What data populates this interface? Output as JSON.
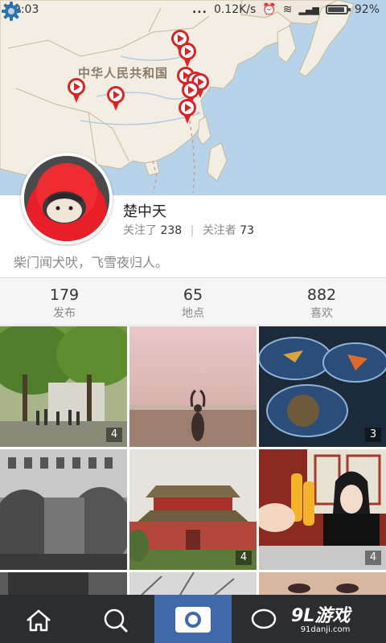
{
  "status_bar": {
    "time": "19:03",
    "dots": "...",
    "speed": "0.12K/s",
    "battery": "92%"
  },
  "map": {
    "label": "中华人民共和国",
    "pin_icon": "play-pin-icon",
    "settings_icon": "gear-icon",
    "accent": "#2f73ad"
  },
  "profile": {
    "name": "楚中天",
    "following_label": "关注了",
    "following_count": "238",
    "separator": "|",
    "followers_label": "关注者",
    "followers_count": "73",
    "bio": "柴门闻犬吠，飞雪夜归人。"
  },
  "stats": [
    {
      "value": "179",
      "label": "发布"
    },
    {
      "value": "65",
      "label": "地点"
    },
    {
      "value": "882",
      "label": "喜欢"
    }
  ],
  "photos": [
    {
      "count": "4"
    },
    {
      "count": ""
    },
    {
      "count": "3"
    },
    {
      "count": ""
    },
    {
      "count": "4"
    },
    {
      "count": "4"
    }
  ],
  "nav": {
    "items": [
      "home-icon",
      "search-icon",
      "camera-icon",
      "chat-icon",
      "profile-icon"
    ],
    "active_color": "#3f69a8",
    "bar_color": "#2b2d31"
  },
  "watermark": {
    "text": "9L游戏",
    "sub": "91danji.com"
  }
}
